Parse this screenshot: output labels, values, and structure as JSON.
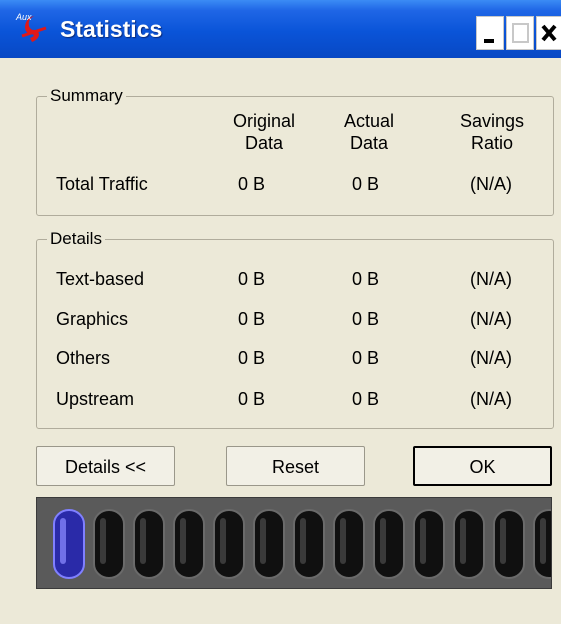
{
  "window": {
    "title": "Statistics",
    "app_icon": "app-logo-icon",
    "controls": [
      "minimize-icon",
      "maximize-icon",
      "close-icon"
    ]
  },
  "summary": {
    "legend": "Summary",
    "headers": {
      "original": [
        "Original",
        "Data"
      ],
      "actual": [
        "Actual",
        "Data"
      ],
      "savings": [
        "Savings",
        "Ratio"
      ]
    },
    "row": {
      "label": "Total Traffic",
      "original": "0 B",
      "actual": "0 B",
      "savings": "(N/A)"
    }
  },
  "details": {
    "legend": "Details",
    "rows": [
      {
        "label": "Text-based",
        "original": "0 B",
        "actual": "0 B",
        "savings": "(N/A)"
      },
      {
        "label": "Graphics",
        "original": "0 B",
        "actual": "0 B",
        "savings": "(N/A)"
      },
      {
        "label": "Others",
        "original": "0 B",
        "actual": "0 B",
        "savings": "(N/A)"
      },
      {
        "label": "Upstream",
        "original": "0 B",
        "actual": "0 B",
        "savings": "(N/A)"
      }
    ]
  },
  "buttons": {
    "details": "Details <<",
    "reset": "Reset",
    "ok": "OK"
  },
  "meter": {
    "total_pills": 13,
    "active_pills": 1,
    "active_color": "#2a2aa8",
    "inactive_color": "#101010"
  },
  "colors": {
    "titlebar": "#0a54d8",
    "dialog_bg": "#ece9d8",
    "meter_bg": "#5a5a5a"
  }
}
